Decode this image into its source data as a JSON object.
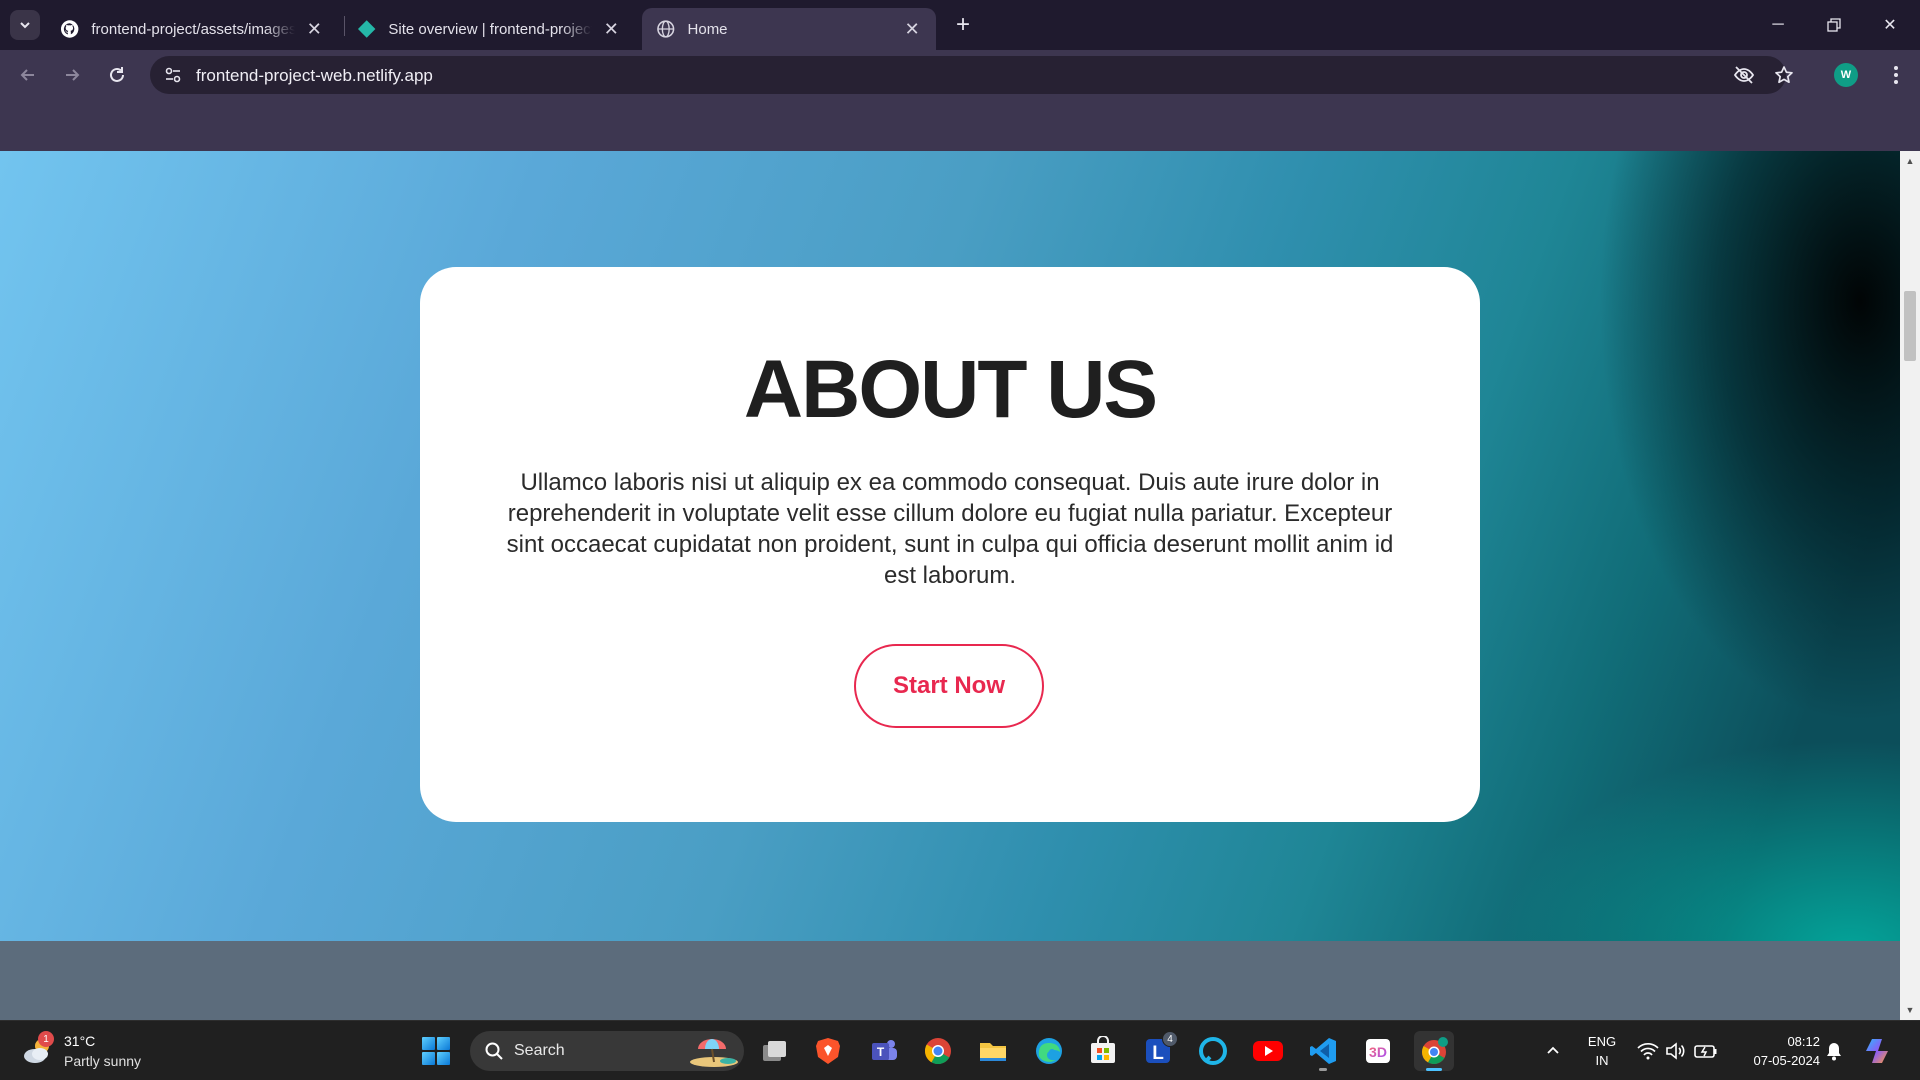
{
  "browser": {
    "tabs": [
      {
        "title": "frontend-project/assets/images",
        "icon": "github-icon",
        "active": false
      },
      {
        "title": "Site overview | frontend-project",
        "icon": "netlify-icon",
        "active": false
      },
      {
        "title": "Home",
        "icon": "globe-icon",
        "active": true
      }
    ],
    "url": "frontend-project-web.netlify.app",
    "profile_initial": "W"
  },
  "page": {
    "about": {
      "title": "ABOUT US",
      "body": "Ullamco laboris nisi ut aliquip ex ea commodo consequat. Duis aute irure dolor in reprehenderit in voluptate velit esse cillum dolore eu fugiat nulla pariatur. Excepteur sint occaecat cupidatat non proident, sunt in culpa qui officia deserunt mollit anim id est laborum.",
      "button_label": "Start Now"
    },
    "colors": {
      "accent": "#e8284f",
      "title": "#1f1f1f"
    }
  },
  "taskbar": {
    "weather": {
      "temp": "31°C",
      "condition": "Partly sunny",
      "badge": "1"
    },
    "search_label": "Search",
    "apps": [
      {
        "name": "task-view-icon"
      },
      {
        "name": "brave-icon"
      },
      {
        "name": "teams-icon"
      },
      {
        "name": "chrome-icon"
      },
      {
        "name": "file-explorer-icon"
      },
      {
        "name": "edge-icon"
      },
      {
        "name": "store-icon"
      },
      {
        "name": "lumi-icon",
        "badge": "4"
      },
      {
        "name": "alexa-icon"
      },
      {
        "name": "youtube-icon"
      },
      {
        "name": "vscode-icon"
      },
      {
        "name": "3d-viewer-icon"
      },
      {
        "name": "chrome-profile-icon"
      }
    ],
    "language": {
      "line1": "ENG",
      "line2": "IN"
    },
    "time": "08:12",
    "date": "07-05-2024"
  }
}
